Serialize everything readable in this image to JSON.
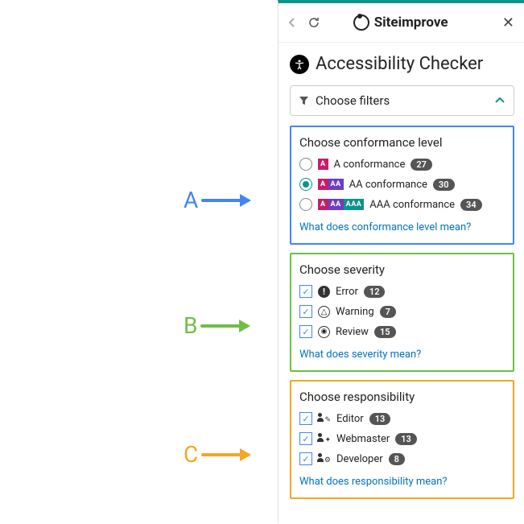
{
  "header": {
    "brand": "Siteimprove"
  },
  "title": "Accessibility Checker",
  "filter_label": "Choose filters",
  "callouts": {
    "a": "A",
    "b": "B",
    "c": "C"
  },
  "conformance": {
    "heading": "Choose conformance level",
    "options": [
      {
        "label": "A conformance",
        "count": "27",
        "tags": [
          "A"
        ],
        "checked": false
      },
      {
        "label": "AA conformance",
        "count": "30",
        "tags": [
          "A",
          "AA"
        ],
        "checked": true
      },
      {
        "label": "AAA conformance",
        "count": "34",
        "tags": [
          "A",
          "AA",
          "AAA"
        ],
        "checked": false
      }
    ],
    "help": "What does conformance level mean?"
  },
  "severity": {
    "heading": "Choose severity",
    "options": [
      {
        "label": "Error",
        "count": "12",
        "icon": "err",
        "checked": true
      },
      {
        "label": "Warning",
        "count": "7",
        "icon": "warn",
        "checked": true
      },
      {
        "label": "Review",
        "count": "15",
        "icon": "rev",
        "checked": true
      }
    ],
    "help": "What does severity mean?"
  },
  "responsibility": {
    "heading": "Choose responsibility",
    "options": [
      {
        "label": "Editor",
        "count": "13",
        "extra": "✎",
        "checked": true
      },
      {
        "label": "Webmaster",
        "count": "13",
        "extra": "✦",
        "checked": true
      },
      {
        "label": "Developer",
        "count": "8",
        "extra": "⚙",
        "checked": true
      }
    ],
    "help": "What does responsibility mean?"
  }
}
